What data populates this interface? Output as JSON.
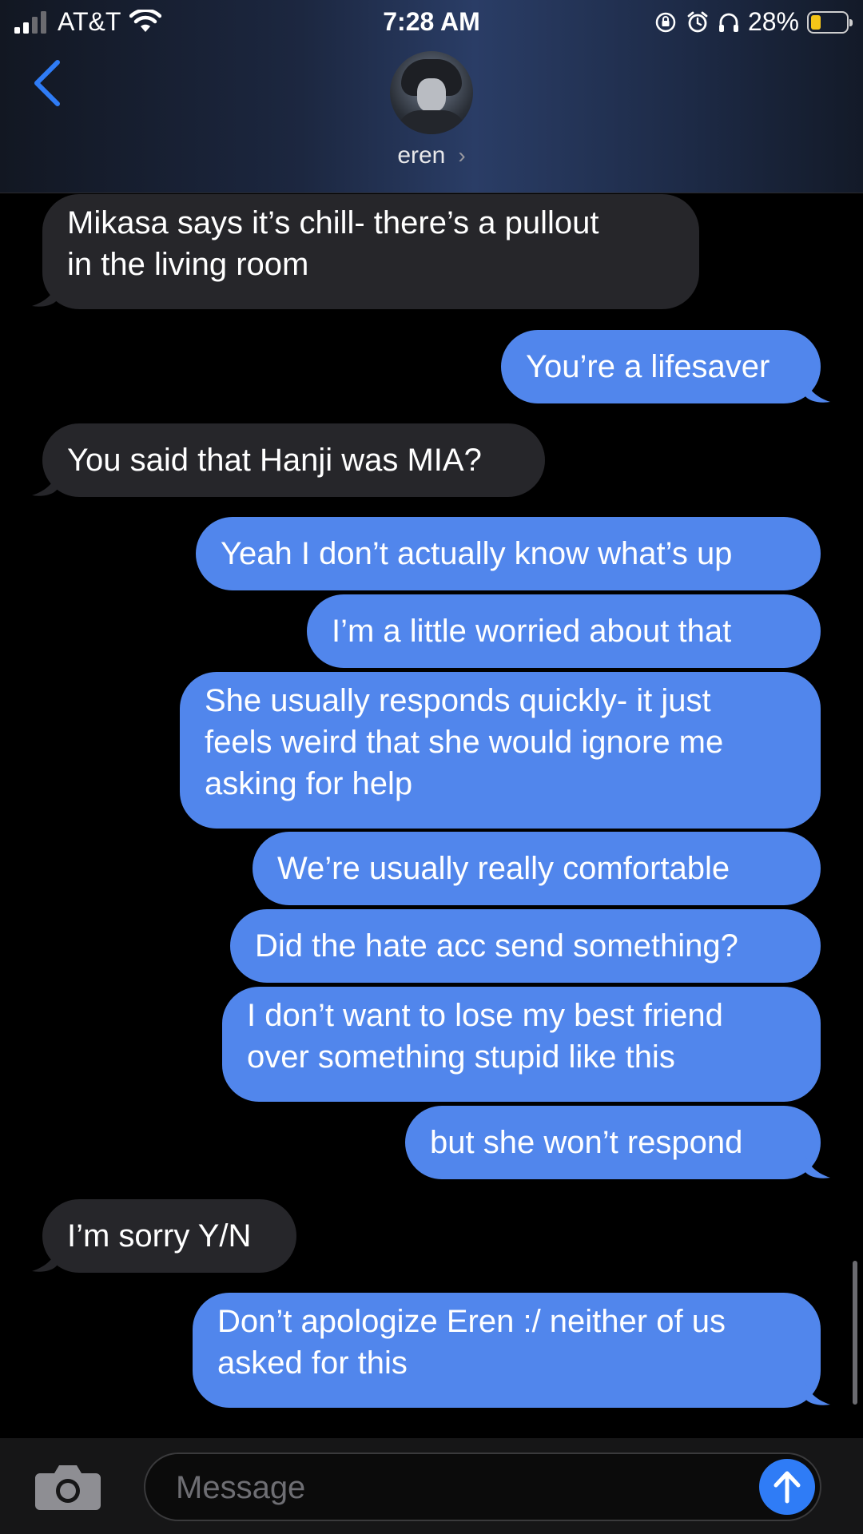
{
  "status_bar": {
    "carrier": "AT&T",
    "time": "7:28 AM",
    "battery_percent": "28%",
    "battery_level": 0.28,
    "icons": [
      "signal-icon",
      "wifi-icon",
      "orientation-lock-icon",
      "alarm-icon",
      "headphones-icon",
      "battery-icon"
    ]
  },
  "header": {
    "contact_name": "eren",
    "chevron": "›"
  },
  "messages": [
    {
      "from": "them",
      "text": "Mikasa says it’s chill- there’s a pullout\nin the living room"
    },
    {
      "from": "me",
      "text": "You’re a lifesaver"
    },
    {
      "from": "them",
      "text": "You said that Hanji was MIA?"
    },
    {
      "from": "me",
      "text": "Yeah I don’t actually know what’s up"
    },
    {
      "from": "me",
      "text": "I’m a little worried about that"
    },
    {
      "from": "me",
      "text": "She usually responds quickly- it just\nfeels weird that she would ignore me\nasking for help"
    },
    {
      "from": "me",
      "text": "We’re usually really comfortable"
    },
    {
      "from": "me",
      "text": "Did the hate acc send something?"
    },
    {
      "from": "me",
      "text": "I don’t want to lose my best friend\nover something stupid like this"
    },
    {
      "from": "me",
      "text": "but she won’t respond"
    },
    {
      "from": "them",
      "text": "I’m sorry Y/N"
    },
    {
      "from": "me",
      "text": "Don’t apologize Eren :/ neither of us\nasked for this"
    }
  ],
  "input": {
    "placeholder": "Message",
    "value": ""
  },
  "colors": {
    "outgoing_bubble": "#5186ec",
    "incoming_bubble": "#26262a",
    "accent": "#2f7cf6",
    "battery": "#f5c518"
  }
}
